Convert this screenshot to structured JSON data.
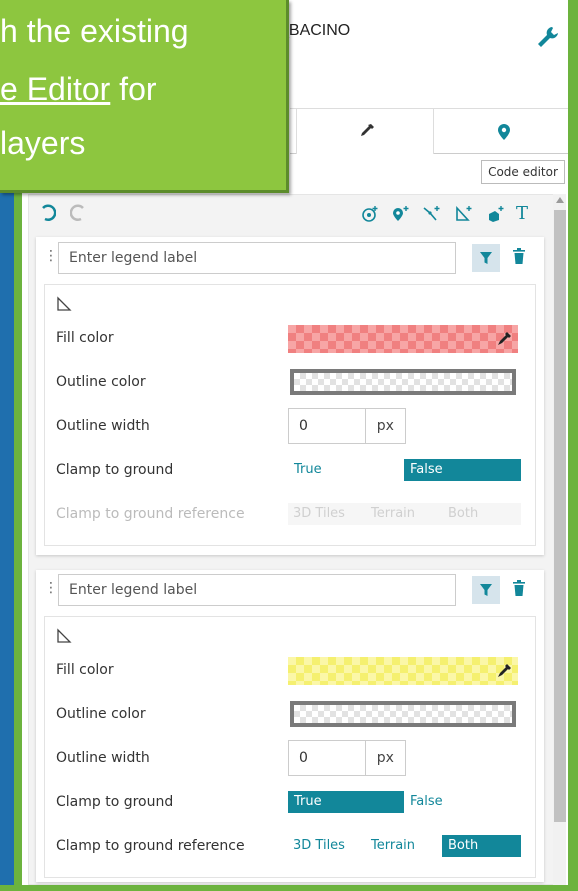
{
  "tooltip": {
    "line1": "h the existing",
    "line2_link": "e Editor",
    "line2_rest": " for",
    "line3": " layers"
  },
  "header": {
    "title": "_BACINO",
    "settings_icon": "wrench-icon"
  },
  "tabs": [
    {
      "icon": "eyedropper-icon",
      "active": true
    },
    {
      "icon": "map-pin-icon",
      "active": false
    }
  ],
  "code_editor_label": "Code editor",
  "toolbar": {
    "icons": [
      "undo-icon",
      "redo-icon",
      "add-point-icon",
      "add-marker-icon",
      "add-line-icon",
      "add-polygon-icon",
      "add-model-icon",
      "add-text-icon"
    ]
  },
  "styles": [
    {
      "legend_placeholder": "Enter legend label",
      "geometry_icon": "polygon-icon",
      "fill_color_label": "Fill color",
      "outline_color_label": "Outline color",
      "outline_width_label": "Outline width",
      "outline_width_value": "0",
      "outline_width_unit": "px",
      "clamp_label": "Clamp to ground",
      "clamp_options": [
        "True",
        "False"
      ],
      "clamp_selected": "False",
      "clamp_ref_label": "Clamp to ground reference",
      "clamp_ref_options": [
        "3D Tiles",
        "Terrain",
        "Both"
      ],
      "clamp_ref_enabled": false,
      "fill_color": "#f08080"
    },
    {
      "legend_placeholder": "Enter legend label",
      "geometry_icon": "polygon-icon",
      "fill_color_label": "Fill color",
      "outline_color_label": "Outline color",
      "outline_width_label": "Outline width",
      "outline_width_value": "0",
      "outline_width_unit": "px",
      "clamp_label": "Clamp to ground",
      "clamp_options": [
        "True",
        "False"
      ],
      "clamp_selected": "True",
      "clamp_ref_label": "Clamp to ground reference",
      "clamp_ref_options": [
        "3D Tiles",
        "Terrain",
        "Both"
      ],
      "clamp_ref_selected": "Both",
      "clamp_ref_enabled": true,
      "fill_color": "#f5f070"
    }
  ],
  "colors": {
    "accent": "#12879a",
    "frame_green": "#6cb33e",
    "frame_blue": "#1f6fae",
    "tooltip_green": "#8dc63f"
  }
}
